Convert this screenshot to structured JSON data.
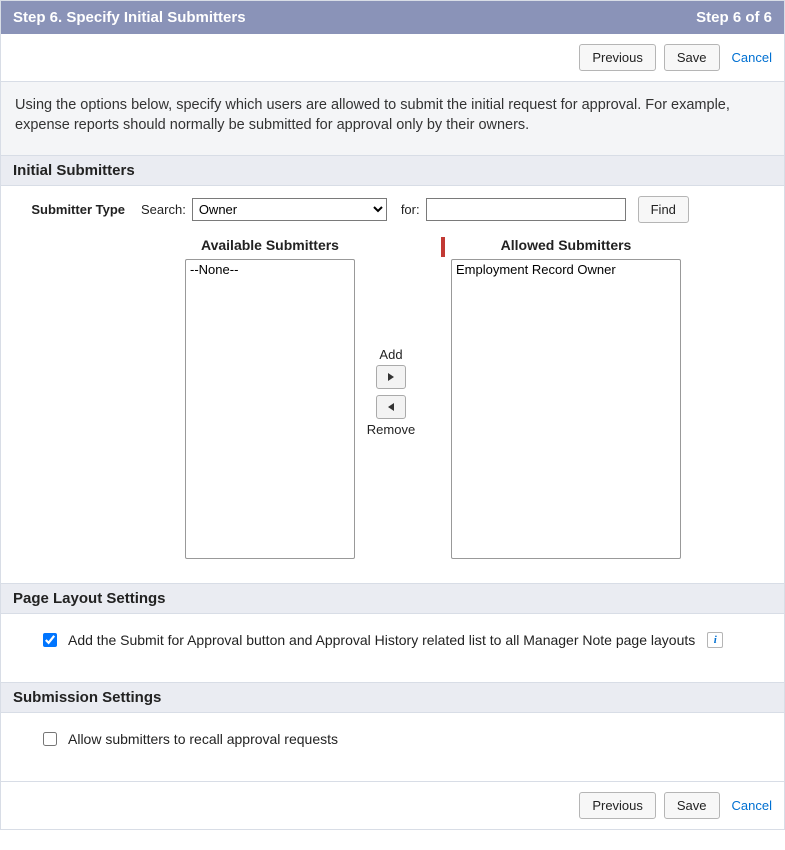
{
  "header": {
    "title": "Step 6. Specify Initial Submitters",
    "step_indicator": "Step 6 of 6"
  },
  "actions": {
    "previous": "Previous",
    "save": "Save",
    "cancel": "Cancel"
  },
  "instructions": "Using the options below, specify which users are allowed to submit the initial request for approval. For example, expense reports should normally be submitted for approval only by their owners.",
  "sections": {
    "initial_submitters": {
      "title": "Initial Submitters",
      "field_label": "Submitter Type",
      "search_label": "Search:",
      "search_select_value": "Owner",
      "for_label": "for:",
      "for_value": "",
      "find_button": "Find",
      "available_title": "Available Submitters",
      "allowed_title": "Allowed Submitters",
      "available_items": [
        "--None--"
      ],
      "allowed_items": [
        "Employment Record Owner"
      ],
      "add_label": "Add",
      "remove_label": "Remove"
    },
    "page_layout": {
      "title": "Page Layout Settings",
      "checkbox_label": "Add the Submit for Approval button and Approval History related list to all Manager Note page layouts",
      "checked": true
    },
    "submission": {
      "title": "Submission Settings",
      "checkbox_label": "Allow submitters to recall approval requests",
      "checked": false
    }
  }
}
